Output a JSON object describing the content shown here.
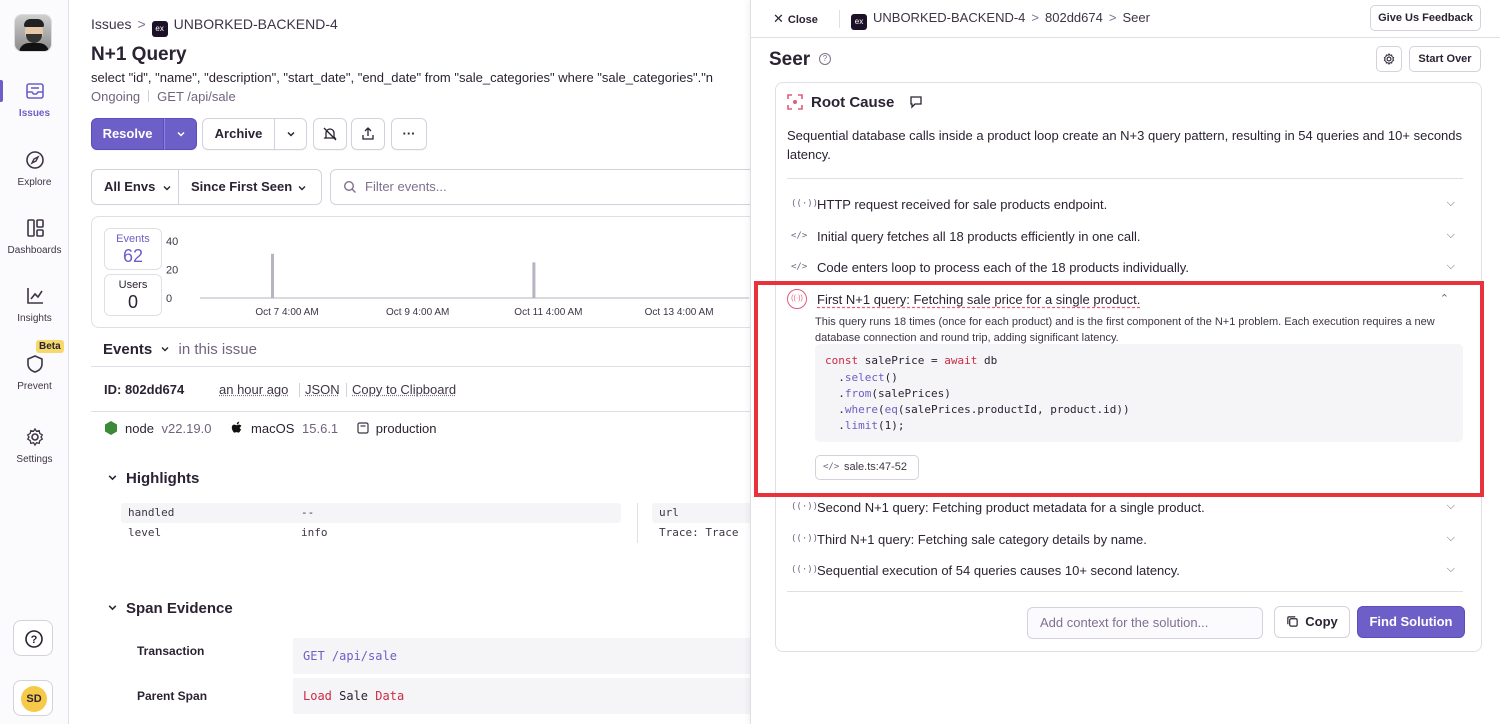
{
  "sidebar": {
    "items": [
      {
        "label": "Issues",
        "icon": "inbox-icon"
      },
      {
        "label": "Explore",
        "icon": "compass-icon"
      },
      {
        "label": "Dashboards",
        "icon": "dashboard-icon"
      },
      {
        "label": "Insights",
        "icon": "graph-icon"
      },
      {
        "label": "Prevent",
        "icon": "shield-icon"
      },
      {
        "label": "Settings",
        "icon": "gear-icon"
      }
    ],
    "beta_badge": "Beta",
    "help_label": "?",
    "user_initials": "SD"
  },
  "breadcrumb": {
    "root": "Issues",
    "sep": ">",
    "project_icon": "ex",
    "project": "UNBORKED-BACKEND-4"
  },
  "issue": {
    "title": "N+1 Query",
    "message": "select \"id\", \"name\", \"description\", \"start_date\", \"end_date\" from \"sale_categories\" where \"sale_categories\".\"n",
    "status": "Ongoing",
    "transaction": "GET /api/sale"
  },
  "actions": {
    "resolve": "Resolve",
    "archive": "Archive",
    "more": "···"
  },
  "filters": {
    "env": "All Envs",
    "period": "Since First Seen",
    "search_placeholder": "Filter events..."
  },
  "stats": {
    "events_label": "Events",
    "events_value": "62",
    "users_label": "Users",
    "users_value": "0"
  },
  "chart_data": {
    "type": "bar",
    "y_ticks": [
      "40",
      "20",
      "0"
    ],
    "ylim": [
      0,
      40
    ],
    "x_ticks": [
      "Oct 7 4:00 AM",
      "Oct 9 4:00 AM",
      "Oct 11 4:00 AM",
      "Oct 13 4:00 AM"
    ],
    "spikes": [
      {
        "position": "Oct 7 4:00 AM",
        "value": 31
      },
      {
        "position": "Oct 11 4:00 AM",
        "value": 25
      }
    ]
  },
  "events_section": {
    "title": "Events",
    "scope": "in this issue",
    "id_label": "ID: 802dd674",
    "time": "an hour ago",
    "json": "JSON",
    "copy": "Copy to Clipboard",
    "node": "node",
    "node_ver": "v22.19.0",
    "os": "macOS",
    "os_ver": "15.6.1",
    "env": "production"
  },
  "highlights": {
    "title": "Highlights",
    "rows": [
      {
        "key": "handled",
        "value": "--"
      },
      {
        "key": "level",
        "value": "info"
      }
    ],
    "right_rows": [
      {
        "key": "url"
      },
      {
        "key": "Trace: Trace"
      }
    ]
  },
  "span_evidence": {
    "title": "Span Evidence",
    "transaction_label": "Transaction",
    "transaction_value": "GET /api/sale",
    "parent_label": "Parent Span",
    "parent_value_parts": [
      "Load",
      " Sale ",
      "Data"
    ]
  },
  "seer": {
    "close": "Close",
    "crumb_project_icon": "ex",
    "crumb_project": "UNBORKED-BACKEND-4",
    "crumb_event": "802dd674",
    "crumb_page": "Seer",
    "feedback": "Give Us Feedback",
    "title": "Seer",
    "start_over": "Start Over",
    "root_cause_title": "Root Cause",
    "root_cause_desc": "Sequential database calls inside a product loop create an N+3 query pattern, resulting in 54 queries and 10+ seconds latency.",
    "steps_before": [
      {
        "icon": "((·))",
        "text": "HTTP request received for sale products endpoint."
      },
      {
        "icon": "</>",
        "text": "Initial query fetches all 18 products efficiently in one call."
      },
      {
        "icon": "</>",
        "text": "Code enters loop to process each of the 18 products individually."
      }
    ],
    "expanded_step": {
      "icon": "((·))",
      "title": "First N+1 query: Fetching sale price for a single product.",
      "desc": "This query runs 18 times (once for each product) and is the first component of the N+1 problem. Each execution requires a new database connection and round trip, adding significant latency.",
      "file": "sale.ts:47-52"
    },
    "steps_after": [
      {
        "icon": "((·))",
        "text": "Second N+1 query: Fetching product metadata for a single product."
      },
      {
        "icon": "((·))",
        "text": "Third N+1 query: Fetching sale category details by name."
      },
      {
        "icon": "((·))",
        "text": "Sequential execution of 54 queries causes 10+ second latency."
      }
    ],
    "context_placeholder": "Add context for the solution...",
    "copy": "Copy",
    "find_solution": "Find Solution"
  },
  "colors": {
    "accent": "#6c5fc7",
    "highlight": "#e8323c",
    "pink": "#e35b7c",
    "beta": "#f5d96b"
  }
}
